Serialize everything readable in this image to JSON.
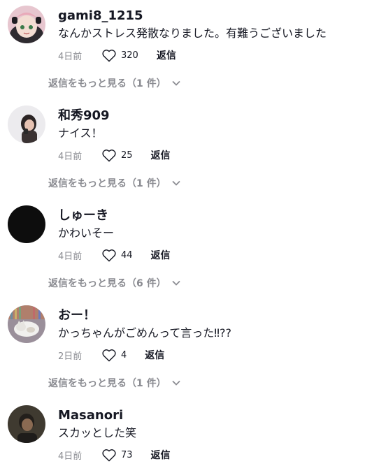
{
  "comments": [
    {
      "username": "gami8_1215",
      "text": "なんかストレス発散なりました。有難うございました",
      "time": "4日前",
      "likes": "320",
      "reply_label": "返信",
      "more_replies": "返信をもっと見る（1 件）"
    },
    {
      "username": "和秀909",
      "text": "ナイス！",
      "time": "4日前",
      "likes": "25",
      "reply_label": "返信",
      "more_replies": "返信をもっと見る（1 件）"
    },
    {
      "username": "しゅーき",
      "text": "かわいそー",
      "time": "4日前",
      "likes": "44",
      "reply_label": "返信",
      "more_replies": "返信をもっと見る（6 件）"
    },
    {
      "username": "おー！",
      "text": "かっちゃんがごめんって言った‼︎??",
      "time": "2日前",
      "likes": "4",
      "reply_label": "返信",
      "more_replies": "返信をもっと見る（1 件）"
    },
    {
      "username": "Masanori",
      "text": "スカッとした笑",
      "time": "4日前",
      "likes": "73",
      "reply_label": "返信"
    }
  ],
  "icons": {
    "like": "heart-outline-icon",
    "expand": "chevron-down-icon"
  },
  "colors": {
    "primary_text": "#161823",
    "secondary_text": "#8a8b91"
  }
}
